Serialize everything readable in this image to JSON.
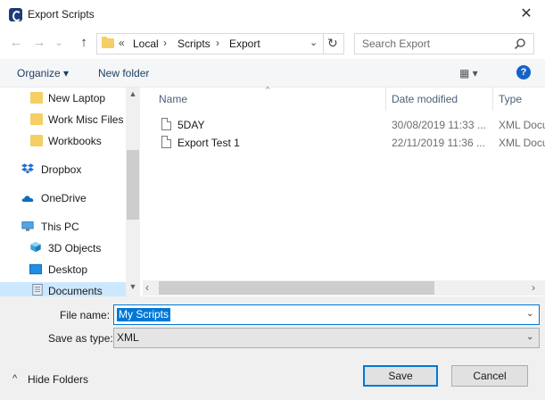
{
  "window": {
    "title": "Export Scripts",
    "close_glyph": "✕"
  },
  "nav": {
    "back": "←",
    "forward": "→",
    "recent": "⌄",
    "up": "↑",
    "breadcrumb_overflow": "«",
    "crumbs": [
      "Local",
      "Scripts",
      "Export"
    ],
    "separator": "›",
    "dropdown": "⌄",
    "refresh": "↻"
  },
  "search": {
    "placeholder": "Search Export",
    "icon": "magnifier-icon"
  },
  "toolbar": {
    "organize": "Organize ▾",
    "new_folder": "New folder",
    "view": "▦ ▾",
    "help": "?"
  },
  "sidebar": {
    "items": [
      {
        "label": "New Laptop",
        "icon": "folder-icon"
      },
      {
        "label": "Work Misc Files",
        "icon": "folder-icon"
      },
      {
        "label": "Workbooks",
        "icon": "folder-icon"
      },
      {
        "label": "Dropbox",
        "icon": "dropbox-icon"
      },
      {
        "label": "OneDrive",
        "icon": "onedrive-icon"
      },
      {
        "label": "This PC",
        "icon": "pc-icon"
      },
      {
        "label": "3D Objects",
        "icon": "3d-objects-icon"
      },
      {
        "label": "Desktop",
        "icon": "desktop-icon"
      },
      {
        "label": "Documents",
        "icon": "documents-icon"
      }
    ],
    "selected": "Documents"
  },
  "files": {
    "columns": {
      "name": "Name",
      "date": "Date modified",
      "type": "Type"
    },
    "rows": [
      {
        "name": "5DAY",
        "date": "30/08/2019 11:33 ...",
        "type": "XML Docu"
      },
      {
        "name": "Export Test 1",
        "date": "22/11/2019 11:36 ...",
        "type": "XML Docu"
      }
    ]
  },
  "form": {
    "file_name_label": "File name:",
    "file_name_value": "My Scripts",
    "save_type_label": "Save as type:",
    "save_type_value": "XML"
  },
  "footer": {
    "hide_folders": "Hide Folders",
    "hide_arrow": "^",
    "save": "Save",
    "cancel": "Cancel"
  },
  "colors": {
    "accent": "#0078d7",
    "selection": "#cce8ff",
    "help": "#1463c9",
    "folder": "#f4cf63"
  }
}
